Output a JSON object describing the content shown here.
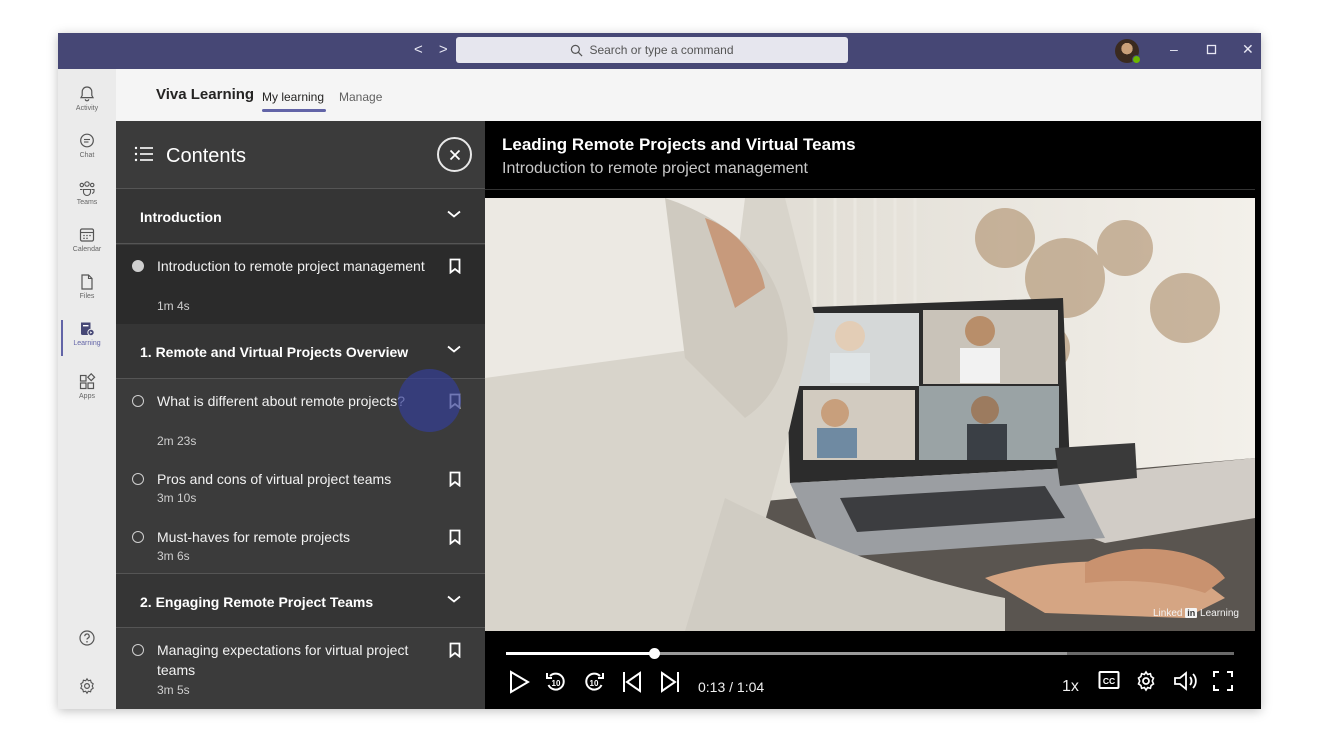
{
  "topbar": {
    "search_placeholder": "Search or type a command",
    "nav_arrows": "< >"
  },
  "rail": {
    "items": [
      {
        "label": "Activity",
        "icon": "bell-icon"
      },
      {
        "label": "Chat",
        "icon": "chat-icon"
      },
      {
        "label": "Teams",
        "icon": "teams-icon"
      },
      {
        "label": "Calendar",
        "icon": "calendar-icon"
      },
      {
        "label": "Files",
        "icon": "file-icon"
      },
      {
        "label": "Learning",
        "icon": "learning-icon",
        "active": true
      },
      {
        "label": "Apps",
        "icon": "apps-icon"
      }
    ],
    "bottom": [
      "help-icon",
      "settings-icon"
    ]
  },
  "app": {
    "title": "Viva Learning",
    "tabs": [
      {
        "label": "My learning",
        "active": true
      },
      {
        "label": "Manage",
        "active": false
      }
    ]
  },
  "contents": {
    "title": "Contents",
    "sections": [
      {
        "label": "Introduction",
        "lessons": [
          {
            "title": "Introduction to remote project management",
            "duration": "1m 4s",
            "current": true
          }
        ]
      },
      {
        "label": "1. Remote and Virtual Projects Overview",
        "lessons": [
          {
            "title": "What is different about remote projects?",
            "duration": "2m 23s"
          },
          {
            "title": "Pros and cons of virtual project teams",
            "duration": "3m 10s"
          },
          {
            "title": "Must-haves for remote projects",
            "duration": "3m 6s"
          }
        ]
      },
      {
        "label": "2. Engaging Remote Project Teams",
        "lessons": [
          {
            "title": "Managing expectations for virtual project teams",
            "duration": "3m 5s"
          }
        ]
      }
    ]
  },
  "player": {
    "course_title": "Leading Remote Projects and Virtual Teams",
    "lesson_title": "Introduction to remote project management",
    "watermark_left": "Linked",
    "watermark_mid": "in",
    "watermark_right": "Learning",
    "time": "0:13 / 1:04",
    "speed": "1x",
    "progress_fraction": 0.203,
    "buffered_fraction": 0.77,
    "cc_label": "CC",
    "skip_seconds": "10"
  },
  "colors": {
    "titlebar": "#464775",
    "accent": "#6264a7",
    "panel": "#3b3b3b"
  }
}
